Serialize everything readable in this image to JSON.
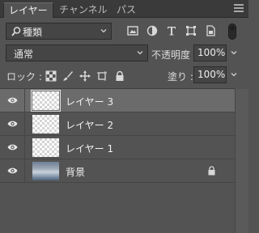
{
  "tabs": [
    {
      "label": "レイヤー",
      "active": true
    },
    {
      "label": "チャンネル",
      "active": false
    },
    {
      "label": "パス",
      "active": false
    }
  ],
  "filter": {
    "kind_label": "種類"
  },
  "blend": {
    "mode": "通常",
    "opacity_label": "不透明度 :",
    "opacity_value": "100%"
  },
  "lock": {
    "label": "ロック :",
    "fill_label": "塗り :",
    "fill_value": "100%"
  },
  "layers": [
    {
      "name": "レイヤー 3",
      "selected": true,
      "thumbnail": "transparent"
    },
    {
      "name": "レイヤー 2",
      "selected": false,
      "thumbnail": "transparent"
    },
    {
      "name": "レイヤー 1",
      "selected": false,
      "thumbnail": "transparent"
    },
    {
      "name": "背景",
      "selected": false,
      "thumbnail": "photo",
      "locked": true
    }
  ],
  "colors": {
    "panel_bg": "#535353",
    "tabbar_bg": "#3a3a3a",
    "selected_row": "#6b6b6b",
    "field_bg": "#454545"
  }
}
